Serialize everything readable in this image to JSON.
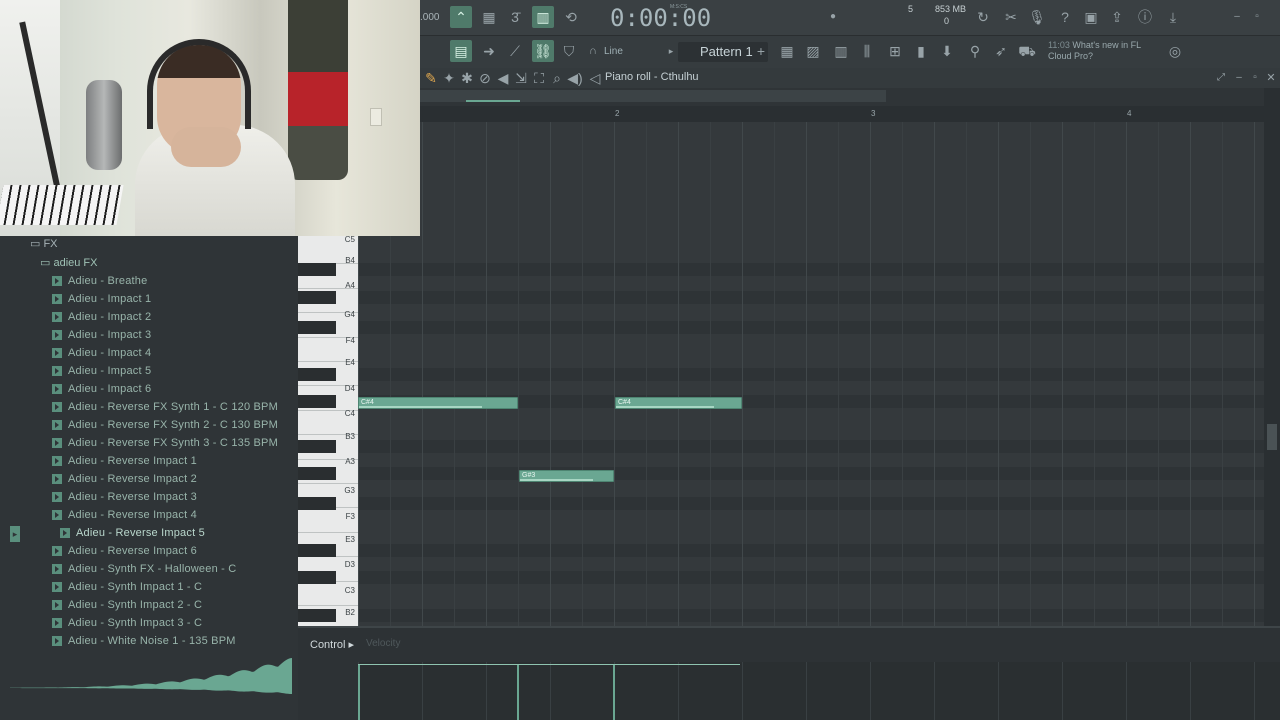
{
  "toolbar": {
    "tempo_fragment": ".000",
    "time": "0:00:00",
    "time_label": "M:S:CS",
    "cpu_count": "5",
    "memory": "853 MB",
    "voices": "0",
    "pattern": "Pattern 1",
    "snap": "Line",
    "news_line1": "11:03",
    "news_line2": "What's new in FL",
    "news_line3": "Cloud Pro?"
  },
  "piano_roll": {
    "title": "Piano roll - Cthulhu",
    "ruler": [
      "2",
      "3",
      "4"
    ],
    "notes": [
      {
        "label": "C#4"
      },
      {
        "label": "C#4"
      },
      {
        "label": "G#3"
      }
    ]
  },
  "keyboard": {
    "labels": [
      "C5",
      "B4",
      "A4",
      "G4",
      "F4",
      "E4",
      "D4",
      "C4",
      "B3",
      "A3",
      "G3",
      "F3",
      "E3",
      "D3",
      "C3",
      "B2"
    ]
  },
  "browser": {
    "folder_root": "FX",
    "folder_sub": "adieu FX",
    "items": [
      "Adieu - Breathe",
      "Adieu - Impact 1",
      "Adieu - Impact 2",
      "Adieu - Impact 3",
      "Adieu - Impact 4",
      "Adieu - Impact 5",
      "Adieu - Impact 6",
      "Adieu - Reverse FX Synth 1 - C 120 BPM",
      "Adieu - Reverse FX Synth 2 - C 130 BPM",
      "Adieu - Reverse FX Synth 3 - C 135 BPM",
      "Adieu - Reverse Impact 1",
      "Adieu - Reverse Impact 2",
      "Adieu - Reverse Impact 3",
      "Adieu - Reverse Impact 4",
      "Adieu - Reverse Impact 5",
      "Adieu - Reverse Impact 6",
      "Adieu - Synth FX - Halloween - C",
      "Adieu - Synth Impact 1 - C",
      "Adieu - Synth Impact 2 - C",
      "Adieu - Synth Impact 3 - C",
      "Adieu - White Noise 1 - 135 BPM"
    ]
  },
  "control": {
    "label": "Control",
    "sub": "Velocity"
  },
  "colors": {
    "accent": "#6aa792",
    "background": "#2f3437"
  }
}
